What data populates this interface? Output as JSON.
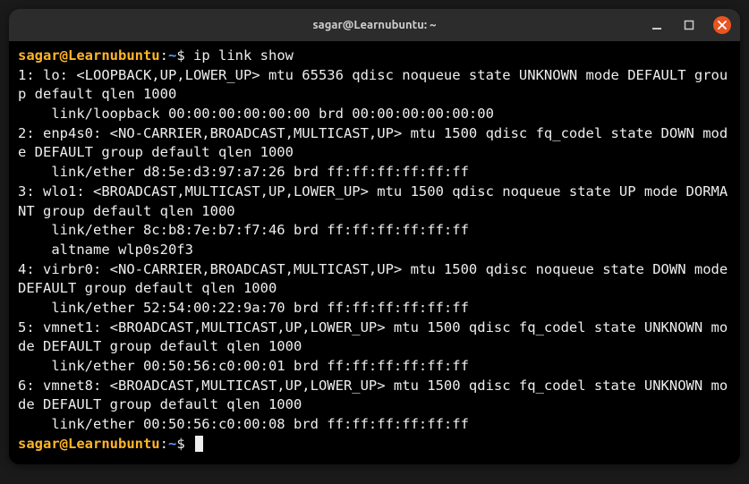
{
  "window": {
    "title": "sagar@Learnubuntu: ~"
  },
  "prompt": {
    "user_host": "sagar@Learnubuntu",
    "path": "~",
    "symbol": "$"
  },
  "command": "ip link show",
  "output_lines": [
    "1: lo: <LOOPBACK,UP,LOWER_UP> mtu 65536 qdisc noqueue state UNKNOWN mode DEFAULT group default qlen 1000",
    "    link/loopback 00:00:00:00:00:00 brd 00:00:00:00:00:00",
    "2: enp4s0: <NO-CARRIER,BROADCAST,MULTICAST,UP> mtu 1500 qdisc fq_codel state DOWN mode DEFAULT group default qlen 1000",
    "    link/ether d8:5e:d3:97:a7:26 brd ff:ff:ff:ff:ff:ff",
    "3: wlo1: <BROADCAST,MULTICAST,UP,LOWER_UP> mtu 1500 qdisc noqueue state UP mode DORMANT group default qlen 1000",
    "    link/ether 8c:b8:7e:b7:f7:46 brd ff:ff:ff:ff:ff:ff",
    "    altname wlp0s20f3",
    "4: virbr0: <NO-CARRIER,BROADCAST,MULTICAST,UP> mtu 1500 qdisc noqueue state DOWN mode DEFAULT group default qlen 1000",
    "    link/ether 52:54:00:22:9a:70 brd ff:ff:ff:ff:ff:ff",
    "5: vmnet1: <BROADCAST,MULTICAST,UP,LOWER_UP> mtu 1500 qdisc fq_codel state UNKNOWN mode DEFAULT group default qlen 1000",
    "    link/ether 00:50:56:c0:00:01 brd ff:ff:ff:ff:ff:ff",
    "6: vmnet8: <BROADCAST,MULTICAST,UP,LOWER_UP> mtu 1500 qdisc fq_codel state UNKNOWN mode DEFAULT group default qlen 1000",
    "    link/ether 00:50:56:c0:00:08 brd ff:ff:ff:ff:ff:ff"
  ]
}
